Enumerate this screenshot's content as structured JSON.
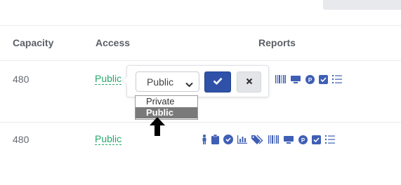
{
  "table": {
    "headers": {
      "capacity": "Capacity",
      "access": "Access",
      "reports": "Reports"
    },
    "rows": [
      {
        "capacity": "480",
        "access": "Public"
      },
      {
        "capacity": "480",
        "access": "Public"
      }
    ]
  },
  "editor": {
    "selected": "Public",
    "options": [
      "Private",
      "Public"
    ],
    "highlighted_index": 1,
    "confirm_icon": "check-icon",
    "cancel_icon": "close-icon"
  },
  "report_icons": [
    "person-icon",
    "clipboard-icon",
    "check-circle-icon",
    "bar-chart-icon",
    "tag-icon",
    "barcode-icon",
    "monitor-icon",
    "parking-icon",
    "checkbox-icon",
    "list-icon"
  ],
  "colors": {
    "accent": "#2f52a8",
    "link": "#27a86b",
    "icon": "#3f5fb5",
    "highlight": "#7a7a7a"
  }
}
